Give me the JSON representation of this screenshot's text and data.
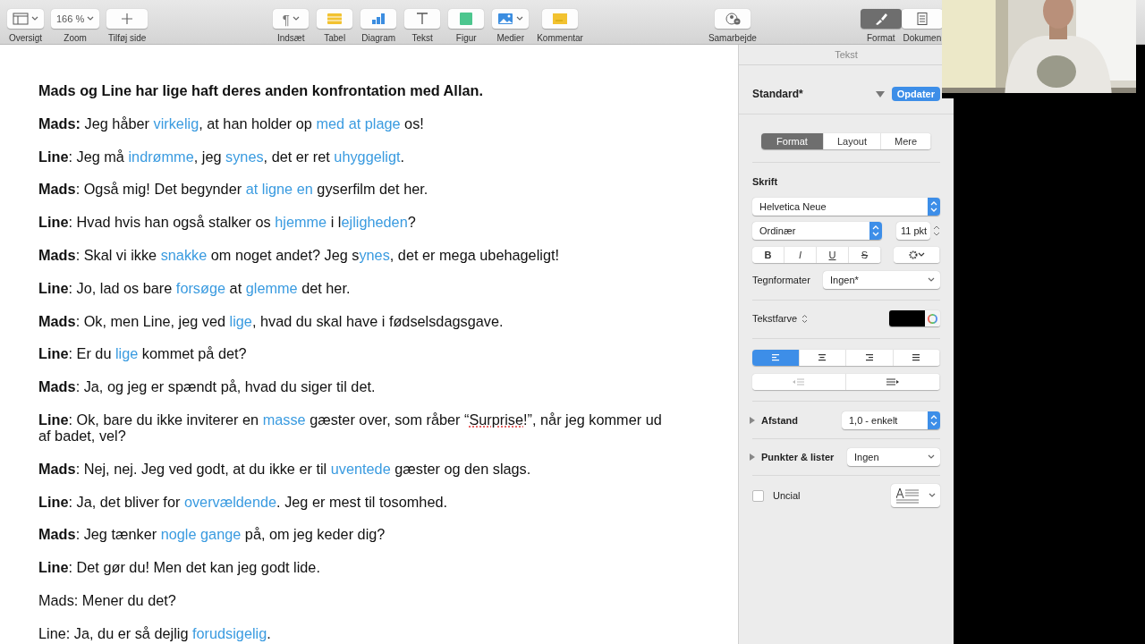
{
  "toolbar": {
    "left": [
      {
        "kind": "view",
        "label": "Oversigt",
        "menu": true
      },
      {
        "kind": "zoom",
        "label": "Zoom",
        "value": "166 %",
        "menu": true
      },
      {
        "kind": "add",
        "label": "Tilføj side",
        "menu": false
      }
    ],
    "center": [
      {
        "kind": "insert",
        "label": "Indsæt",
        "glyph": "¶",
        "menu": true
      },
      {
        "kind": "table",
        "label": "Tabel",
        "menu": false
      },
      {
        "kind": "chart",
        "label": "Diagram",
        "menu": false
      },
      {
        "kind": "text",
        "label": "Tekst",
        "menu": false
      },
      {
        "kind": "shape",
        "label": "Figur",
        "menu": false
      },
      {
        "kind": "media",
        "label": "Medier",
        "menu": true
      },
      {
        "kind": "comment",
        "label": "Kommentar",
        "menu": false
      }
    ],
    "right": [
      {
        "kind": "collaborate",
        "label": "Samarbejde",
        "menu": false
      }
    ],
    "inspector": [
      {
        "kind": "format",
        "label": "Format",
        "selected": true
      },
      {
        "kind": "document",
        "label": "Dokumen",
        "selected": false
      }
    ]
  },
  "document": {
    "paragraphs": [
      [
        {
          "kind": "heading",
          "text": "Mads og Line har lige haft deres anden konfrontation med Allan."
        }
      ],
      [
        {
          "kind": "speaker",
          "text": "Mads:"
        },
        {
          "kind": "plain",
          "text": " Jeg håber "
        },
        {
          "kind": "word",
          "text": "virkelig"
        },
        {
          "kind": "plain",
          "text": ", at han holder op "
        },
        {
          "kind": "word",
          "text": "med at plage"
        },
        {
          "kind": "plain",
          "text": " os!"
        }
      ],
      [
        {
          "kind": "speaker",
          "text": "Line"
        },
        {
          "kind": "plain",
          "text": ": Jeg må "
        },
        {
          "kind": "word",
          "text": "indrømme"
        },
        {
          "kind": "plain",
          "text": ", jeg "
        },
        {
          "kind": "word",
          "text": "synes"
        },
        {
          "kind": "plain",
          "text": ", det er ret "
        },
        {
          "kind": "word",
          "text": "uhyggeligt"
        },
        {
          "kind": "plain",
          "text": "."
        }
      ],
      [
        {
          "kind": "speaker",
          "text": "Mads"
        },
        {
          "kind": "plain",
          "text": ": Også mig! Det begynder "
        },
        {
          "kind": "word",
          "text": "at ligne en"
        },
        {
          "kind": "plain",
          "text": " gyserfilm det her."
        }
      ],
      [
        {
          "kind": "speaker",
          "text": "Line"
        },
        {
          "kind": "plain",
          "text": ": Hvad hvis han også stalker os "
        },
        {
          "kind": "word",
          "text": "hjemme"
        },
        {
          "kind": "plain",
          "text": " i l"
        },
        {
          "kind": "word",
          "text": "ejligheden"
        },
        {
          "kind": "plain",
          "text": "?"
        }
      ],
      [
        {
          "kind": "speaker",
          "text": "Mads"
        },
        {
          "kind": "plain",
          "text": ": Skal vi ikke "
        },
        {
          "kind": "word",
          "text": "snakke"
        },
        {
          "kind": "plain",
          "text": " om noget andet? Jeg s"
        },
        {
          "kind": "word",
          "text": "ynes"
        },
        {
          "kind": "plain",
          "text": ", det er mega ubehageligt!"
        }
      ],
      [
        {
          "kind": "speaker",
          "text": "Line"
        },
        {
          "kind": "plain",
          "text": ": Jo, lad os bare "
        },
        {
          "kind": "word",
          "text": "forsøge"
        },
        {
          "kind": "plain",
          "text": " at "
        },
        {
          "kind": "word",
          "text": "glemme"
        },
        {
          "kind": "plain",
          "text": " det her."
        }
      ],
      [
        {
          "kind": "speaker",
          "text": "Mads"
        },
        {
          "kind": "plain",
          "text": ": Ok, men Line, jeg ved "
        },
        {
          "kind": "word",
          "text": "lige"
        },
        {
          "kind": "plain",
          "text": ", hvad du skal have i fødselsdagsgave."
        }
      ],
      [
        {
          "kind": "speaker",
          "text": "Line"
        },
        {
          "kind": "plain",
          "text": ": Er du "
        },
        {
          "kind": "word",
          "text": "lige"
        },
        {
          "kind": "plain",
          "text": " kommet på det?"
        }
      ],
      [
        {
          "kind": "speaker",
          "text": "Mads"
        },
        {
          "kind": "plain",
          "text": ": Ja, og jeg er spændt på, hvad du siger til det."
        }
      ],
      [
        {
          "kind": "speaker",
          "text": "Line"
        },
        {
          "kind": "plain",
          "text": ": Ok, bare du ikke inviterer en "
        },
        {
          "kind": "word",
          "text": "masse"
        },
        {
          "kind": "plain",
          "text": " gæster over, som råber “"
        },
        {
          "kind": "misspelled",
          "text": "Surprise"
        },
        {
          "kind": "plain",
          "text": "!”, når jeg kommer ud af badet, vel?"
        }
      ],
      [
        {
          "kind": "speaker",
          "text": "Mads"
        },
        {
          "kind": "plain",
          "text": ": Nej, nej. Jeg ved godt, at du ikke er til "
        },
        {
          "kind": "word",
          "text": "uventede"
        },
        {
          "kind": "plain",
          "text": " gæster og den slags."
        }
      ],
      [
        {
          "kind": "speaker",
          "text": "Line"
        },
        {
          "kind": "plain",
          "text": ": Ja, det bliver for "
        },
        {
          "kind": "word",
          "text": "overvældende"
        },
        {
          "kind": "plain",
          "text": ". Jeg er mest til tosomhed."
        }
      ],
      [
        {
          "kind": "speaker",
          "text": "Mads"
        },
        {
          "kind": "plain",
          "text": ": Jeg tænker "
        },
        {
          "kind": "word",
          "text": "nogle gange"
        },
        {
          "kind": "plain",
          "text": " på, om jeg keder dig?"
        }
      ],
      [
        {
          "kind": "speaker",
          "text": "Line"
        },
        {
          "kind": "plain",
          "text": ": Det gør du! Men det kan jeg godt lide."
        }
      ],
      [
        {
          "kind": "plain",
          "text": "Mads: Mener du det?"
        }
      ],
      [
        {
          "kind": "plain",
          "text": "Line: Ja, du er så dejlig "
        },
        {
          "kind": "word",
          "text": "forudsigelig"
        },
        {
          "kind": "plain",
          "text": "."
        }
      ]
    ]
  },
  "inspector": {
    "title": "Tekst",
    "style_name": "Standard*",
    "update_button": "Opdater",
    "tabs": [
      {
        "label": "Format",
        "selected": true
      },
      {
        "label": "Layout",
        "selected": false
      },
      {
        "label": "Mere",
        "selected": false
      }
    ],
    "font_heading": "Skrift",
    "font": "Helvetica Neue",
    "typeface": "Ordinær",
    "size": "11 pkt",
    "style_buttons": [
      {
        "kind": "bold",
        "glyph": "B"
      },
      {
        "kind": "italic",
        "glyph": "I"
      },
      {
        "kind": "underline",
        "glyph": "U"
      },
      {
        "kind": "strike",
        "glyph": "S"
      }
    ],
    "char_styles": {
      "label": "Tegnformater",
      "value": "Ingen*"
    },
    "text_color": {
      "label": "Tekstfarve",
      "color": "#000000"
    },
    "alignment": [
      {
        "kind": "left",
        "selected": true
      },
      {
        "kind": "center",
        "selected": false
      },
      {
        "kind": "right",
        "selected": false
      },
      {
        "kind": "justify",
        "selected": false
      }
    ],
    "indent": [
      {
        "kind": "decrease",
        "disabled": true
      },
      {
        "kind": "increase",
        "disabled": false
      }
    ],
    "sections": [
      {
        "kind": "stepper",
        "label": "Afstand",
        "value": "1,0 - enkelt",
        "expanded": false
      },
      {
        "kind": "popup",
        "label": "Punkter & lister",
        "value": "Ingen",
        "expanded": false
      }
    ],
    "drop_cap": {
      "label": "Uncial",
      "checked": false
    }
  }
}
